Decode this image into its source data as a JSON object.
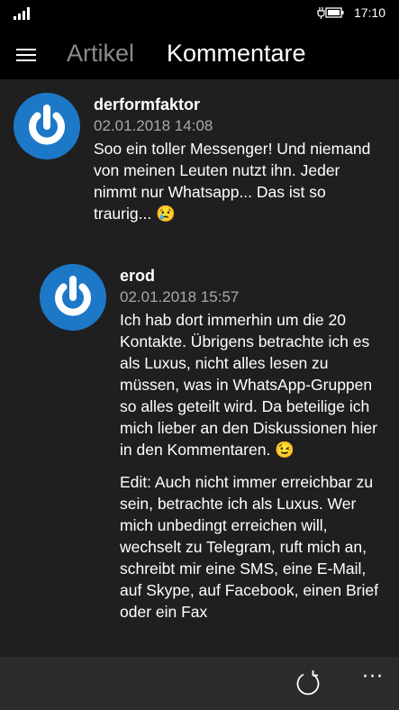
{
  "status_bar": {
    "time": "17:10",
    "signal_icon": "signal-bars-icon",
    "battery_icon": "battery-charging-icon"
  },
  "header": {
    "menu_icon": "hamburger-icon",
    "tabs": [
      {
        "label": "Artikel",
        "active": false
      },
      {
        "label": "Kommentare",
        "active": true
      }
    ]
  },
  "comments": [
    {
      "author": "derformfaktor",
      "date": "02.01.2018 14:08",
      "text": [
        "Soo ein toller Messenger! Und niemand von meinen Leuten nutzt ihn. Jeder nimmt nur Whatsapp... Das ist so traurig... 😢"
      ],
      "avatar_icon": "power-button-icon"
    },
    {
      "author": "erod",
      "date": "02.01.2018 15:57",
      "text": [
        "Ich hab dort immerhin um die 20 Kontakte. Übrigens betrachte ich es als Luxus, nicht alles lesen zu müssen, was in WhatsApp-Gruppen so alles geteilt wird. Da beteilige ich mich lieber an den Diskussionen hier in den Kommentaren. 😉",
        "Edit: Auch nicht immer erreichbar zu sein, betrachte ich als Luxus. Wer mich unbedingt erreichen will, wechselt zu Telegram, ruft mich an, schreibt mir eine SMS, eine E-Mail, auf Skype, auf Facebook, einen Brief oder ein Fax"
      ],
      "avatar_icon": "power-button-icon"
    }
  ],
  "app_bar": {
    "refresh_icon": "refresh-icon",
    "more_label": "···"
  },
  "colors": {
    "avatar_blue": "#1d78c8",
    "background": "#1f1f1f",
    "app_bar": "#2b2b2b",
    "inactive_tab": "#8a8a8a"
  }
}
